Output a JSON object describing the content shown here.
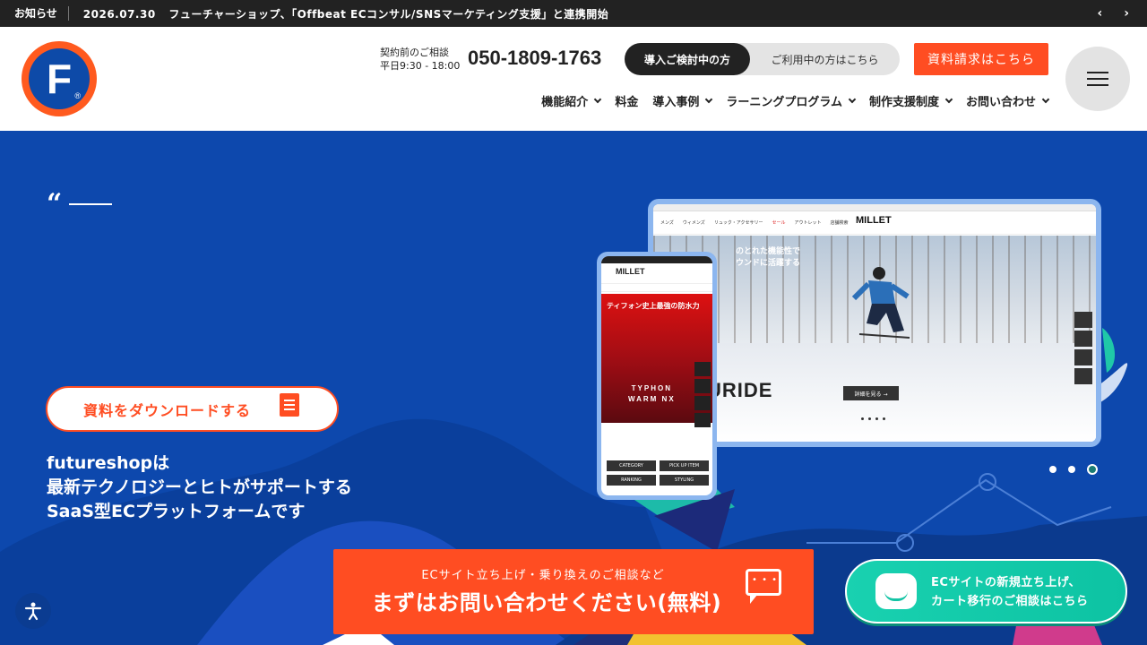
{
  "newsbar": {
    "label": "お知らせ",
    "date": "2026.07.30",
    "headline": "フューチャーショップ、「Offbeat ECコンサル/SNSマーケティング支援」と連携開始",
    "prev_icon": "‹",
    "next_icon": "›"
  },
  "header": {
    "logo_letter": "F",
    "logo_reg": "®",
    "contact_label_1": "契約前のご相談",
    "contact_label_2": "平日9:30 - 18:00",
    "phone": "050-1809-1763",
    "toggle_active": "導入ご検討中の方",
    "toggle_inactive": "ご利用中の方はこちら",
    "request_button": "資料請求はこちら",
    "nav": [
      {
        "label": "機能紹介",
        "has_menu": true
      },
      {
        "label": "料金",
        "has_menu": false
      },
      {
        "label": "導入事例",
        "has_menu": true
      },
      {
        "label": "ラーニングプログラム",
        "has_menu": true
      },
      {
        "label": "制作支援制度",
        "has_menu": true
      },
      {
        "label": "お問い合わせ",
        "has_menu": true
      }
    ]
  },
  "hero": {
    "quote_mark": "“",
    "download_button": "資料をダウンロードする",
    "tagline_1": "futureshopは",
    "tagline_2": "最新テクノロジーとヒトがサポートする",
    "tagline_3": "SaaS型ECプラットフォームです",
    "tablet": {
      "brand": "MILLET",
      "nav": [
        "メンズ",
        "ウィメンズ",
        "リュック・アクセサリー",
        "セール",
        "アウトレット",
        "店舗検索"
      ],
      "copy_1": "のとれた機能性で",
      "copy_2": "ウンドに活躍する",
      "word": "URIDE",
      "more": "詳細を見る →"
    },
    "phone": {
      "brand": "MILLET",
      "title": "ティフォン史上最強の防水力",
      "product_1": "TYPHON",
      "product_2": "WARM NX",
      "buttons": [
        "CATEGORY",
        "PICK UP ITEM",
        "RANKING",
        "STYLING"
      ]
    },
    "slides_count": 3,
    "active_slide": 3
  },
  "cta_main": {
    "small": "ECサイト立ち上げ・乗り換えのご相談など",
    "big": "まずはお問い合わせください(無料)"
  },
  "cta_side": {
    "line_1": "ECサイトの新規立ち上げ、",
    "line_2": "カート移行のご相談はこちら"
  },
  "colors": {
    "accent": "#ff4d22",
    "hero_bg": "#0d48ad",
    "dark": "#222222",
    "teal": "#14c4a5"
  },
  "icons": {
    "menu": "hamburger-icon",
    "accessibility": "accessibility-icon",
    "chat": "chat-bubble-icon",
    "document": "document-icon"
  }
}
